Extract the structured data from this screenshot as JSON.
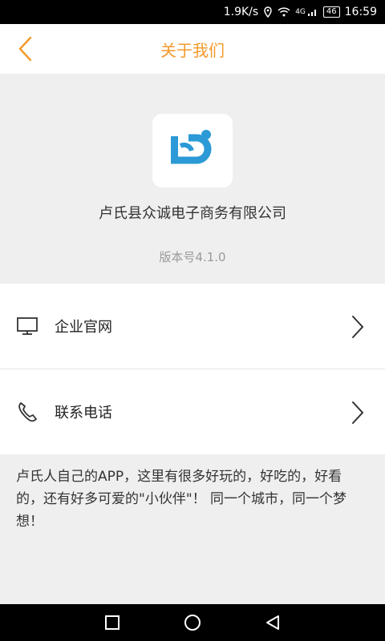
{
  "statusbar": {
    "speed": "1.9K/s",
    "network": "4G",
    "battery": "46",
    "time": "16:59"
  },
  "header": {
    "title": "关于我们"
  },
  "about": {
    "company_name": "卢氏县众诚电子商务有限公司",
    "version": "版本号4.1.0"
  },
  "menu": [
    {
      "label": "企业官网",
      "icon": "monitor-icon"
    },
    {
      "label": "联系电话",
      "icon": "phone-icon"
    }
  ],
  "description": "卢氏人自己的APP，这里有很多好玩的，好吃的，好看的，还有好多可爱的\"小伙伴\"！ 同一个城市，同一个梦想！",
  "colors": {
    "accent": "#f39a2b",
    "logo_blue": "#2b9ad6"
  }
}
